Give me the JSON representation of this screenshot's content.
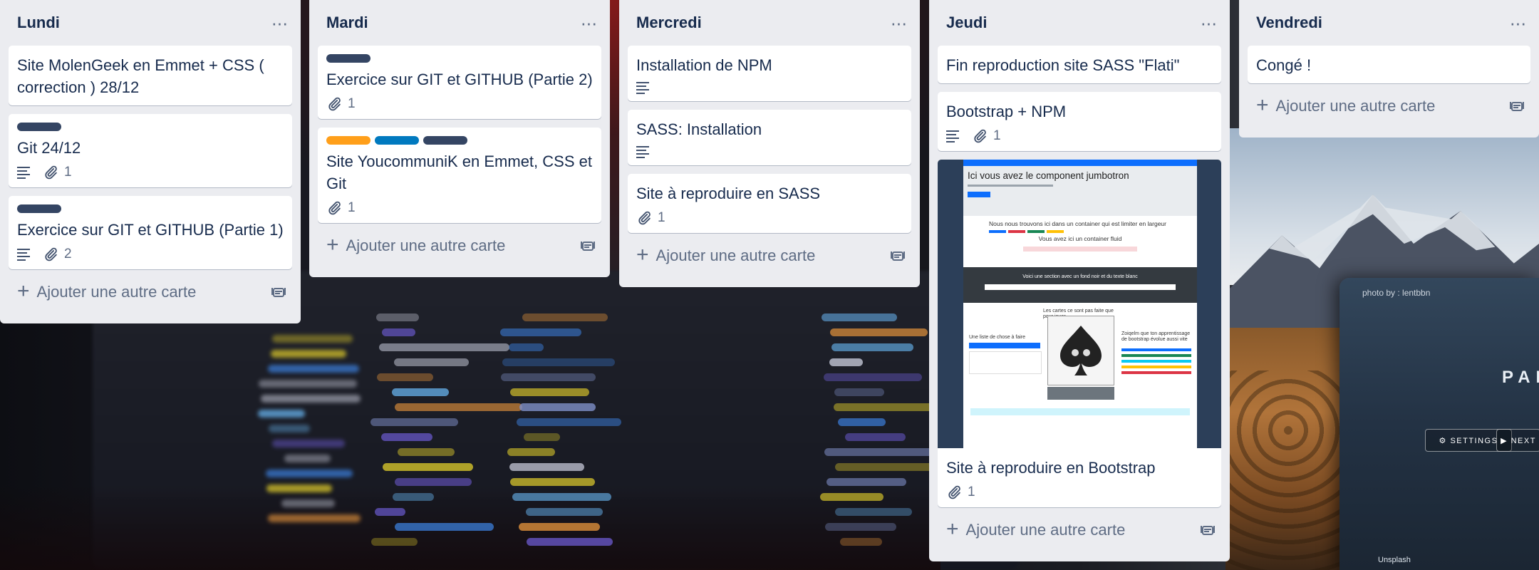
{
  "lists": [
    {
      "title": "Lundi",
      "cards": [
        {
          "title": "Site MolenGeek en Emmet + CSS ( correction ) 28/12",
          "labels": [],
          "description": false,
          "attachments": null
        },
        {
          "title": "Git 24/12",
          "labels": [
            "#344563"
          ],
          "description": true,
          "attachments": "1"
        },
        {
          "title": "Exercice sur GIT et GITHUB (Partie 1)",
          "labels": [
            "#344563"
          ],
          "description": true,
          "attachments": "2"
        }
      ],
      "add_label": "Ajouter une autre carte"
    },
    {
      "title": "Mardi",
      "cards": [
        {
          "title": "Exercice sur GIT et GITHUB (Partie 2)",
          "labels": [
            "#344563"
          ],
          "description": false,
          "attachments": "1"
        },
        {
          "title": "Site YoucommuniK en Emmet, CSS et Git",
          "labels": [
            "#ff9f1a",
            "#0079bf",
            "#344563"
          ],
          "description": false,
          "attachments": "1"
        }
      ],
      "add_label": "Ajouter une autre carte"
    },
    {
      "title": "Mercredi",
      "cards": [
        {
          "title": "Installation de NPM",
          "labels": [],
          "description": true,
          "attachments": null
        },
        {
          "title": "SASS: Installation",
          "labels": [],
          "description": true,
          "attachments": null
        },
        {
          "title": "Site à reproduire en SASS",
          "labels": [],
          "description": false,
          "attachments": "1"
        }
      ],
      "add_label": "Ajouter une autre carte"
    },
    {
      "title": "Jeudi",
      "cards": [
        {
          "title": "Fin reproduction site SASS \"Flati\"",
          "labels": [],
          "description": false,
          "attachments": null
        },
        {
          "title": "Bootstrap + NPM",
          "labels": [],
          "description": true,
          "attachments": "1"
        },
        {
          "title": "Site à reproduire en Bootstrap",
          "labels": [],
          "description": false,
          "attachments": "1",
          "cover": {
            "heading": "Ici vous avez le component jumbotron",
            "line1": "Nous nous trouvons ici dans un container qui est limiter en largeur",
            "line2": "Vous avez ici un container fluid",
            "line3": "Voici une section avec un fond noir et du texte blanc",
            "line4": "Les cartes ce sont pas faite que pour jouer",
            "line5": "Une liste de chose à faire",
            "line6": "Zoiqelm que ton apprentissage de bootstrap évolue aussi vite"
          }
        }
      ],
      "add_label": "Ajouter une autre carte"
    },
    {
      "title": "Vendredi",
      "cards": [
        {
          "title": "Congé !",
          "labels": [],
          "description": false,
          "attachments": null
        }
      ],
      "add_label": "Ajouter une autre carte"
    }
  ],
  "icons": {
    "list_menu": "ellipsis-icon",
    "description": "description-icon",
    "attachment": "paperclip-icon",
    "add": "plus-icon",
    "template": "card-template-icon"
  },
  "background": {
    "photo_credit": "photo by : lentbbn",
    "photo_title": "PAP",
    "button1": "⚙ SETTINGS",
    "button2": "▶ NEXT",
    "unsplash": "Unsplash"
  },
  "colors": {
    "list_bg": "#ebecf0",
    "card_bg": "#ffffff",
    "text": "#172b4d",
    "muted": "#5e6c84",
    "label_dark": "#344563",
    "label_orange": "#ff9f1a",
    "label_blue": "#0079bf"
  }
}
